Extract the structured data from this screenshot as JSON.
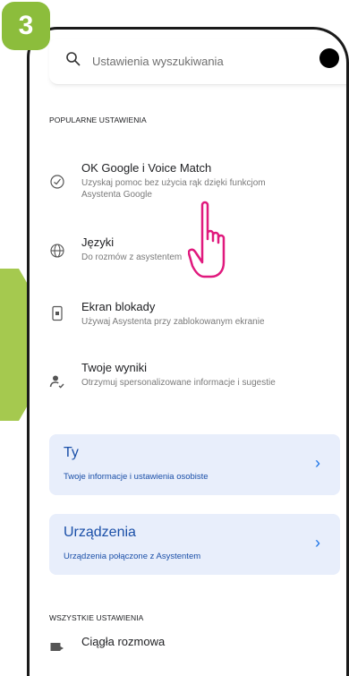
{
  "step": {
    "number": "3"
  },
  "search": {
    "placeholder": "Ustawienia wyszukiwania"
  },
  "sections": {
    "popular": "POPULARNE USTAWIENIA",
    "all": "WSZYSTKIE USTAWIENIA"
  },
  "items": [
    {
      "title": "OK Google i Voice Match",
      "desc": "Uzyskaj pomoc bez użycia rąk dzięki funkcjom Asystenta Google",
      "icon": "voice-check-icon"
    },
    {
      "title": "Języki",
      "desc": "Do rozmów z asystentem",
      "icon": "globe-icon"
    },
    {
      "title": "Ekran blokady",
      "desc": "Używaj Asystenta przy zablokowanym ekranie",
      "icon": "lock-screen-icon"
    },
    {
      "title": "Twoje wyniki",
      "desc": "Otrzymuj spersonalizowane informacje i sugestie",
      "icon": "person-results-icon"
    }
  ],
  "cards": [
    {
      "title": "Ty",
      "desc": "Twoje informacje i ustawienia osobiste"
    },
    {
      "title": "Urządzenia",
      "desc": "Urządzenia połączone z Asystentem"
    }
  ],
  "bottom_item": {
    "title": "Ciągła rozmowa",
    "icon": "conversation-icon"
  },
  "colors": {
    "step_badge": "#8cbd3c",
    "arrow": "#a5c94f",
    "card_bg": "#e8eefb",
    "card_text": "#1a4fa8",
    "hand_outline": "#e0197d"
  }
}
